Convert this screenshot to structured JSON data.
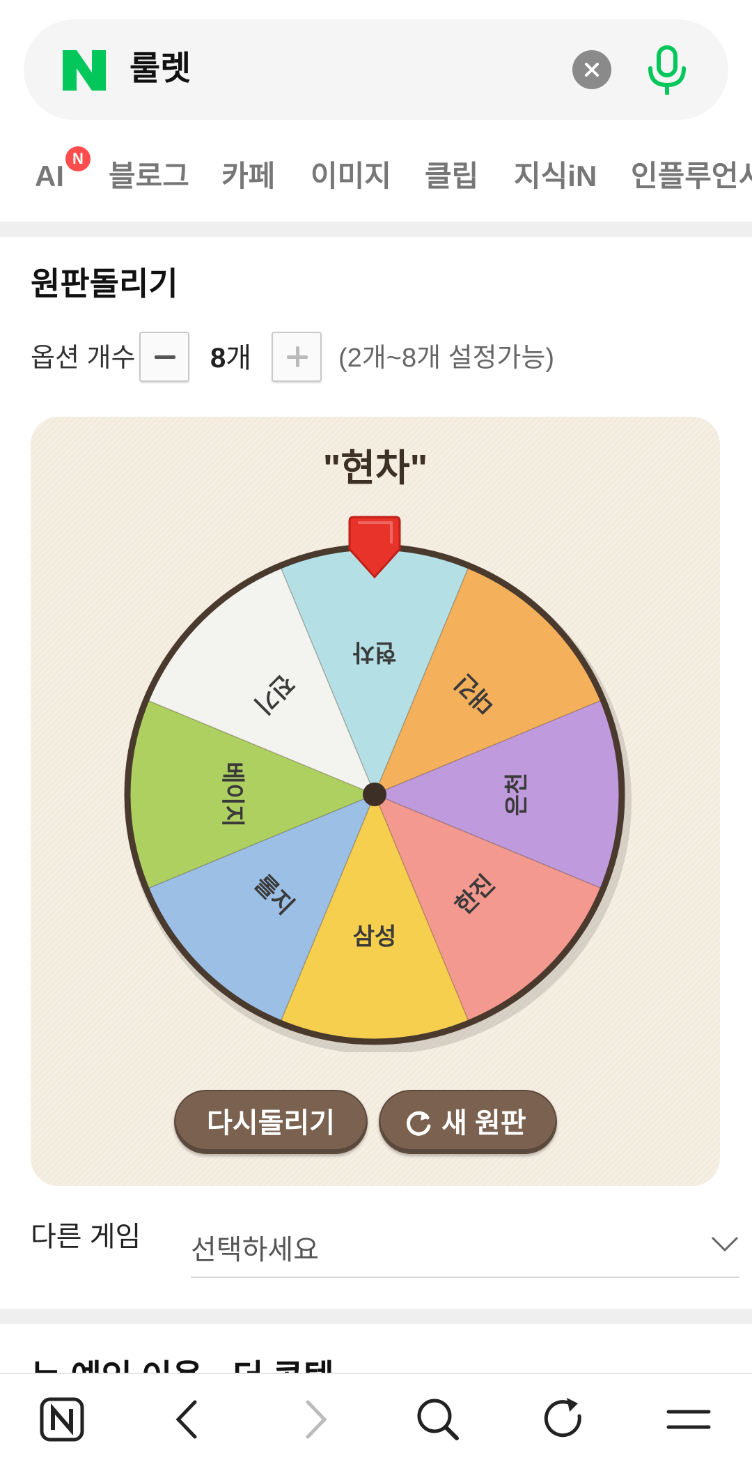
{
  "search": {
    "logo_letter": "N",
    "query": "룰렛",
    "clear": "clear-icon",
    "voice": "microphone-icon"
  },
  "tabs": [
    {
      "label": "AI",
      "badge": "N"
    },
    {
      "label": "블로그"
    },
    {
      "label": "카페"
    },
    {
      "label": "이미지"
    },
    {
      "label": "클립"
    },
    {
      "label": "지식iN"
    },
    {
      "label": "인플루언서"
    }
  ],
  "widget": {
    "title": "원판돌리기",
    "option_label": "옵션 개수",
    "option_count": "8",
    "option_unit": "개",
    "range_hint": "(2개~8개 설정가능)",
    "result": "\"현차\"",
    "wheel": {
      "segments": [
        {
          "label": "현차",
          "color": "#b3dfe5"
        },
        {
          "label": "대긴",
          "color": "#f5b05c"
        },
        {
          "label": "은천",
          "color": "#bf9adc"
        },
        {
          "label": "한진",
          "color": "#f3998f"
        },
        {
          "label": "삼성",
          "color": "#f7cf4f"
        },
        {
          "label": "롤지",
          "color": "#9cbfe6"
        },
        {
          "label": "베이지",
          "color": "#aed060"
        },
        {
          "label": "진기",
          "color": "#f3f3f0"
        }
      ],
      "rim_color": "#4a3a2e",
      "pointer_color": "#e8332b"
    },
    "respin_label": "다시돌리기",
    "new_wheel_label": "새 원판",
    "other_game_label": "다른 게임",
    "select_value": "선택하세요"
  },
  "peek_title": "누 예인 이용 · 더 콘텐",
  "bottom_nav": [
    "naver-home-icon",
    "back-icon",
    "forward-icon",
    "search-icon",
    "refresh-icon",
    "menu-icon"
  ]
}
